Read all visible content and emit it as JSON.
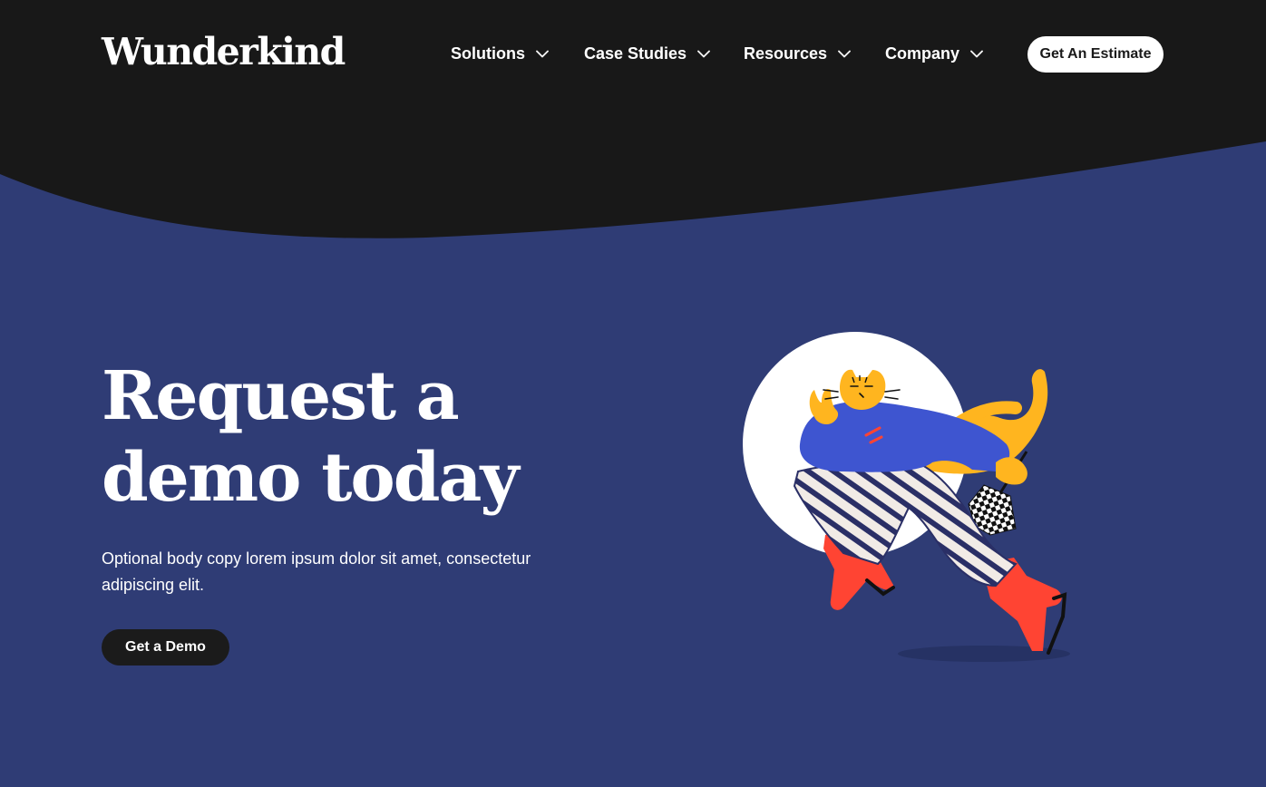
{
  "brand": {
    "logo_text": "Wunderkind"
  },
  "nav": {
    "items": [
      {
        "label": "Solutions",
        "icon": "chevron-down-icon"
      },
      {
        "label": "Case Studies",
        "icon": "chevron-down-icon"
      },
      {
        "label": "Resources",
        "icon": "chevron-down-icon"
      },
      {
        "label": "Company",
        "icon": "chevron-down-icon"
      }
    ],
    "cta_label": "Get An Estimate"
  },
  "hero": {
    "title_line1": "Request a",
    "title_line2": "demo today",
    "body": "Optional body copy lorem ipsum dolor sit amet, consectetur adipiscing elit.",
    "cta_label": "Get a Demo",
    "illustration": "running-cat-character-illustration"
  },
  "colors": {
    "header_bg": "#181818",
    "hero_bg": "#2f3c75",
    "button_light": "#ffffff",
    "button_dark": "#1b1b1b"
  }
}
